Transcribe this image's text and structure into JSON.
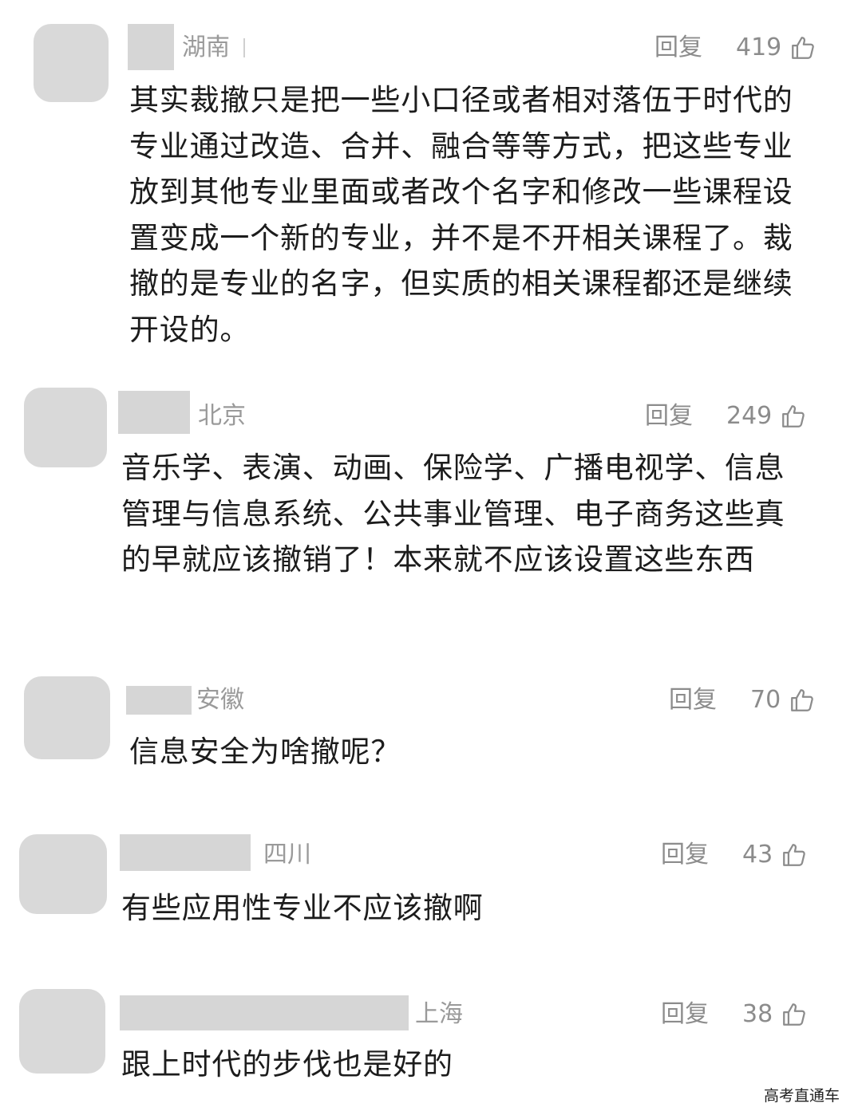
{
  "comments": [
    {
      "region": "湖南",
      "reply_label": "回复",
      "likes": "419",
      "text": "其实裁撤只是把一些小口径或者相对落伍于时代的专业通过改造、合并、融合等等方式，把这些专业放到其他专业里面或者改个名字和修改一些课程设置变成一个新的专业，并不是不开相关课程了。裁撤的是专业的名字，但实质的相关课程都还是继续开设的。"
    },
    {
      "region": "北京",
      "reply_label": "回复",
      "likes": "249",
      "text": "音乐学、表演、动画、保险学、广播电视学、信息管理与信息系统、公共事业管理、电子商务这些真的早就应该撤销了！本来就不应该设置这些东西"
    },
    {
      "region": "安徽",
      "reply_label": "回复",
      "likes": "70",
      "text": "信息安全为啥撤呢？"
    },
    {
      "region": "四川",
      "reply_label": "回复",
      "likes": "43",
      "text": "有些应用性专业不应该撤啊"
    },
    {
      "region": "上海",
      "reply_label": "回复",
      "likes": "38",
      "text": "跟上时代的步伐也是好的"
    }
  ],
  "watermark": "高考直通车",
  "icons": {
    "like": "thumbs-up-icon",
    "avatar": "avatar-placeholder"
  },
  "colors": {
    "placeholder": "#d9d9d9",
    "meta_text": "#8c8c8c",
    "body_text": "#1c1c1c"
  }
}
